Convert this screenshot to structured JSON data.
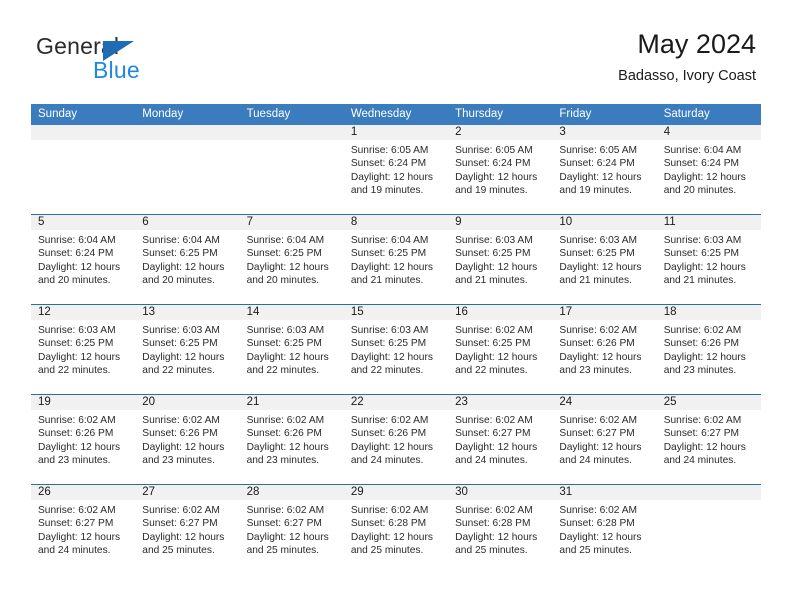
{
  "brand": {
    "name_top": "General",
    "name_bottom": "Blue",
    "flag_color": "#1f6cb4",
    "blue_text_color": "#2288dd"
  },
  "header": {
    "title": "May 2024",
    "subtitle": "Badasso, Ivory Coast"
  },
  "theme": {
    "header_blue": "#3a7cbe",
    "row_divider": "#2e6da4",
    "daynum_band": "#f1f1f1"
  },
  "weekdays": [
    "Sunday",
    "Monday",
    "Tuesday",
    "Wednesday",
    "Thursday",
    "Friday",
    "Saturday"
  ],
  "labels": {
    "sunrise_prefix": "Sunrise:",
    "sunset_prefix": "Sunset:",
    "daylight_prefix": "Daylight:"
  },
  "weeks": [
    [
      {
        "day": "",
        "empty": true
      },
      {
        "day": "",
        "empty": true
      },
      {
        "day": "",
        "empty": true
      },
      {
        "day": "1",
        "sunrise": "Sunrise: 6:05 AM",
        "sunset": "Sunset: 6:24 PM",
        "daylight": "Daylight: 12 hours and 19 minutes."
      },
      {
        "day": "2",
        "sunrise": "Sunrise: 6:05 AM",
        "sunset": "Sunset: 6:24 PM",
        "daylight": "Daylight: 12 hours and 19 minutes."
      },
      {
        "day": "3",
        "sunrise": "Sunrise: 6:05 AM",
        "sunset": "Sunset: 6:24 PM",
        "daylight": "Daylight: 12 hours and 19 minutes."
      },
      {
        "day": "4",
        "sunrise": "Sunrise: 6:04 AM",
        "sunset": "Sunset: 6:24 PM",
        "daylight": "Daylight: 12 hours and 20 minutes."
      }
    ],
    [
      {
        "day": "5",
        "sunrise": "Sunrise: 6:04 AM",
        "sunset": "Sunset: 6:24 PM",
        "daylight": "Daylight: 12 hours and 20 minutes."
      },
      {
        "day": "6",
        "sunrise": "Sunrise: 6:04 AM",
        "sunset": "Sunset: 6:25 PM",
        "daylight": "Daylight: 12 hours and 20 minutes."
      },
      {
        "day": "7",
        "sunrise": "Sunrise: 6:04 AM",
        "sunset": "Sunset: 6:25 PM",
        "daylight": "Daylight: 12 hours and 20 minutes."
      },
      {
        "day": "8",
        "sunrise": "Sunrise: 6:04 AM",
        "sunset": "Sunset: 6:25 PM",
        "daylight": "Daylight: 12 hours and 21 minutes."
      },
      {
        "day": "9",
        "sunrise": "Sunrise: 6:03 AM",
        "sunset": "Sunset: 6:25 PM",
        "daylight": "Daylight: 12 hours and 21 minutes."
      },
      {
        "day": "10",
        "sunrise": "Sunrise: 6:03 AM",
        "sunset": "Sunset: 6:25 PM",
        "daylight": "Daylight: 12 hours and 21 minutes."
      },
      {
        "day": "11",
        "sunrise": "Sunrise: 6:03 AM",
        "sunset": "Sunset: 6:25 PM",
        "daylight": "Daylight: 12 hours and 21 minutes."
      }
    ],
    [
      {
        "day": "12",
        "sunrise": "Sunrise: 6:03 AM",
        "sunset": "Sunset: 6:25 PM",
        "daylight": "Daylight: 12 hours and 22 minutes."
      },
      {
        "day": "13",
        "sunrise": "Sunrise: 6:03 AM",
        "sunset": "Sunset: 6:25 PM",
        "daylight": "Daylight: 12 hours and 22 minutes."
      },
      {
        "day": "14",
        "sunrise": "Sunrise: 6:03 AM",
        "sunset": "Sunset: 6:25 PM",
        "daylight": "Daylight: 12 hours and 22 minutes."
      },
      {
        "day": "15",
        "sunrise": "Sunrise: 6:03 AM",
        "sunset": "Sunset: 6:25 PM",
        "daylight": "Daylight: 12 hours and 22 minutes."
      },
      {
        "day": "16",
        "sunrise": "Sunrise: 6:02 AM",
        "sunset": "Sunset: 6:25 PM",
        "daylight": "Daylight: 12 hours and 22 minutes."
      },
      {
        "day": "17",
        "sunrise": "Sunrise: 6:02 AM",
        "sunset": "Sunset: 6:26 PM",
        "daylight": "Daylight: 12 hours and 23 minutes."
      },
      {
        "day": "18",
        "sunrise": "Sunrise: 6:02 AM",
        "sunset": "Sunset: 6:26 PM",
        "daylight": "Daylight: 12 hours and 23 minutes."
      }
    ],
    [
      {
        "day": "19",
        "sunrise": "Sunrise: 6:02 AM",
        "sunset": "Sunset: 6:26 PM",
        "daylight": "Daylight: 12 hours and 23 minutes."
      },
      {
        "day": "20",
        "sunrise": "Sunrise: 6:02 AM",
        "sunset": "Sunset: 6:26 PM",
        "daylight": "Daylight: 12 hours and 23 minutes."
      },
      {
        "day": "21",
        "sunrise": "Sunrise: 6:02 AM",
        "sunset": "Sunset: 6:26 PM",
        "daylight": "Daylight: 12 hours and 23 minutes."
      },
      {
        "day": "22",
        "sunrise": "Sunrise: 6:02 AM",
        "sunset": "Sunset: 6:26 PM",
        "daylight": "Daylight: 12 hours and 24 minutes."
      },
      {
        "day": "23",
        "sunrise": "Sunrise: 6:02 AM",
        "sunset": "Sunset: 6:27 PM",
        "daylight": "Daylight: 12 hours and 24 minutes."
      },
      {
        "day": "24",
        "sunrise": "Sunrise: 6:02 AM",
        "sunset": "Sunset: 6:27 PM",
        "daylight": "Daylight: 12 hours and 24 minutes."
      },
      {
        "day": "25",
        "sunrise": "Sunrise: 6:02 AM",
        "sunset": "Sunset: 6:27 PM",
        "daylight": "Daylight: 12 hours and 24 minutes."
      }
    ],
    [
      {
        "day": "26",
        "sunrise": "Sunrise: 6:02 AM",
        "sunset": "Sunset: 6:27 PM",
        "daylight": "Daylight: 12 hours and 24 minutes."
      },
      {
        "day": "27",
        "sunrise": "Sunrise: 6:02 AM",
        "sunset": "Sunset: 6:27 PM",
        "daylight": "Daylight: 12 hours and 25 minutes."
      },
      {
        "day": "28",
        "sunrise": "Sunrise: 6:02 AM",
        "sunset": "Sunset: 6:27 PM",
        "daylight": "Daylight: 12 hours and 25 minutes."
      },
      {
        "day": "29",
        "sunrise": "Sunrise: 6:02 AM",
        "sunset": "Sunset: 6:28 PM",
        "daylight": "Daylight: 12 hours and 25 minutes."
      },
      {
        "day": "30",
        "sunrise": "Sunrise: 6:02 AM",
        "sunset": "Sunset: 6:28 PM",
        "daylight": "Daylight: 12 hours and 25 minutes."
      },
      {
        "day": "31",
        "sunrise": "Sunrise: 6:02 AM",
        "sunset": "Sunset: 6:28 PM",
        "daylight": "Daylight: 12 hours and 25 minutes."
      },
      {
        "day": "",
        "empty": true
      }
    ]
  ]
}
